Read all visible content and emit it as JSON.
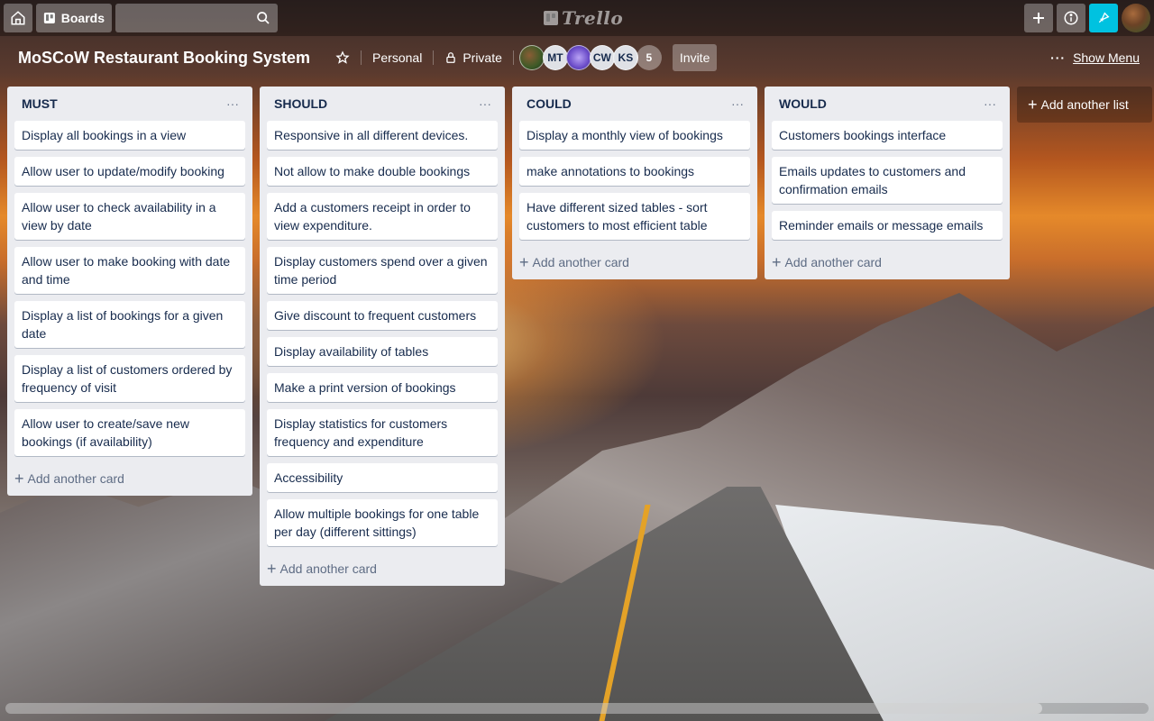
{
  "header": {
    "boards_label": "Boards",
    "search_placeholder": "",
    "logo_text": "Trello"
  },
  "board": {
    "title": "MoSCoW Restaurant Booking System",
    "visibility_team": "Personal",
    "visibility_privacy": "Private",
    "members": [
      "MT",
      "CW",
      "KS"
    ],
    "extra_members_count": "5",
    "invite_label": "Invite",
    "show_menu_label": "Show Menu"
  },
  "lists": [
    {
      "title": "MUST",
      "cards": [
        "Display all bookings in a view",
        "Allow user to update/modify booking",
        "Allow user to check availability in a view by date",
        "Allow user to make booking with date and time",
        "Display a list of bookings for a given date",
        "Display a list of customers ordered by frequency of visit",
        "Allow user to create/save new bookings (if availability)"
      ],
      "add_card_label": "Add another card"
    },
    {
      "title": "SHOULD",
      "cards": [
        "Responsive in all different devices.",
        "Not allow to make double bookings",
        "Add a customers receipt in order to view expenditure.",
        "Display customers spend over a given time period",
        "Give discount to frequent customers",
        "Display availability of tables",
        "Make a print version of bookings",
        "Display statistics for customers frequency and expenditure",
        "Accessibility",
        "Allow multiple bookings for one table per day (different sittings)"
      ],
      "add_card_label": "Add another card"
    },
    {
      "title": "COULD",
      "cards": [
        "Display a monthly view of bookings",
        "make annotations to bookings",
        "Have different sized tables - sort customers to most efficient table"
      ],
      "add_card_label": "Add another card"
    },
    {
      "title": "WOULD",
      "cards": [
        "Customers bookings interface",
        "Emails updates to customers and confirmation emails",
        "Reminder emails or message emails"
      ],
      "add_card_label": "Add another card"
    }
  ],
  "add_list_label": "Add another list",
  "colors": {
    "list_bg": "#ebecf0",
    "card_bg": "#ffffff",
    "text": "#172b4d",
    "muted": "#5e6c84",
    "notification_accent": "#00c2e0"
  }
}
